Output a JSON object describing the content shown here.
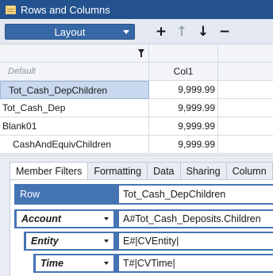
{
  "window": {
    "title": "Rows and Columns"
  },
  "toolbar": {
    "layout_label": "Layout",
    "icons": [
      "plus-icon",
      "arrow-up-icon",
      "arrow-down-icon",
      "minus-icon"
    ]
  },
  "grid": {
    "filter_placeholder": "Default",
    "column_header": "Col1",
    "rows": [
      {
        "label": "Tot_Cash_DepChildren",
        "value": "9,999.99"
      },
      {
        "label": "Tot_Cash_Dep",
        "value": "9,999.99"
      },
      {
        "label": "Blank01",
        "value": "9,999.99"
      },
      {
        "label": "CashAndEquivChildren",
        "value": "9,999.99"
      }
    ]
  },
  "tabs": [
    "Member Filters",
    "Formatting",
    "Data",
    "Sharing",
    "Column"
  ],
  "member_filters": {
    "row_label": "Row",
    "row_value": "Tot_Cash_DepChildren",
    "properties": [
      {
        "name": "Account",
        "value": "A#Tot_Cash_Deposits.Children"
      },
      {
        "name": "Entity",
        "value": "E#|CVEntity|"
      },
      {
        "name": "Time",
        "value": "T#|CVTime|"
      }
    ]
  },
  "colors": {
    "title_bar": "#24528f",
    "accent": "#3767a5",
    "row_bar": "#4574b3",
    "selection": "#c9d8ee"
  }
}
